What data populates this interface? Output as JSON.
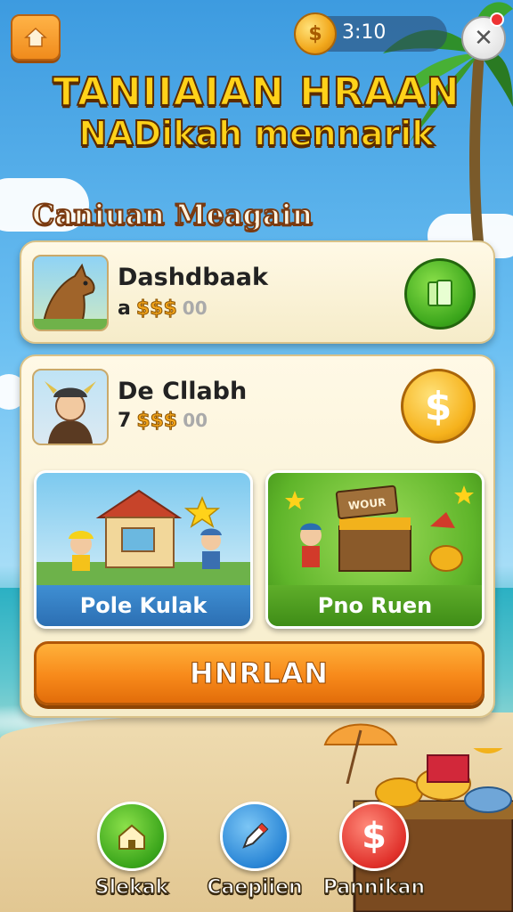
{
  "header": {
    "timer": "3:10"
  },
  "title": {
    "line1": "TANIIAIAN HRAAN",
    "line2": "NADikah mennarik"
  },
  "section_label": "Caniuan Meagain",
  "offers": [
    {
      "name": "Dashdbaak",
      "prefix": "a",
      "price_icons": "$$$",
      "price_suffix": "00"
    },
    {
      "name": "De Cllabh",
      "prefix": "7",
      "price_icons": "$$$",
      "price_suffix": "00"
    }
  ],
  "panels": [
    {
      "label": "Pole Kulak",
      "icon": "shop-scene"
    },
    {
      "label": "Pno Ruen",
      "icon": "treasure-scene",
      "sign": "WOUR"
    }
  ],
  "main_button": "HNRLAN",
  "bottom_nav": [
    {
      "label": "Slekak",
      "icon": "house-icon",
      "color": "#3aa51b"
    },
    {
      "label": "Caepiien",
      "icon": "pencil-icon",
      "color": "#2a86d6"
    },
    {
      "label": "Pannikan",
      "icon": "dollar-icon",
      "color": "#e0302a"
    }
  ],
  "colors": {
    "accent": "#f7891a",
    "title_gold": "#ffd21a",
    "green": "#3aa51b",
    "gold": "#f6b21c"
  }
}
